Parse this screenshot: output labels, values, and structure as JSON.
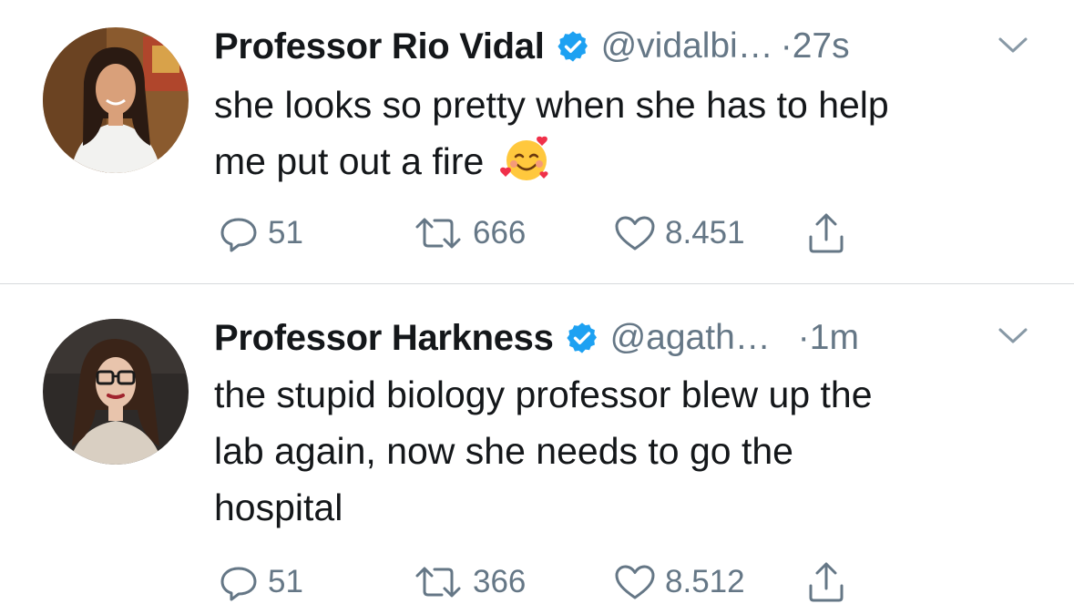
{
  "tweets": [
    {
      "name": "Professor Rio Vidal",
      "handle": "@vidalbi…",
      "separator": "·",
      "time": "27s",
      "text_line1": "she looks so pretty when she has to help",
      "text_line2": "me put out a fire",
      "emoji": "smiling-face-with-hearts",
      "replies": "51",
      "retweets": "666",
      "likes": "8.451"
    },
    {
      "name": "Professor Harkness",
      "handle": "@agath…",
      "separator": "·",
      "time": "1m",
      "text_line1": "the stupid biology professor blew up the",
      "text_line2": "lab again, now she needs to go the",
      "text_line3": "hospital",
      "replies": "51",
      "retweets": "366",
      "likes": "8.512"
    }
  ],
  "colors": {
    "verified": "#1da1f2",
    "secondary_text": "#657786",
    "primary_text": "#14171a",
    "divider": "#d6d9dc"
  },
  "icons": [
    "verified-badge-icon",
    "chevron-down-icon",
    "reply-icon",
    "retweet-icon",
    "like-icon",
    "share-icon"
  ]
}
